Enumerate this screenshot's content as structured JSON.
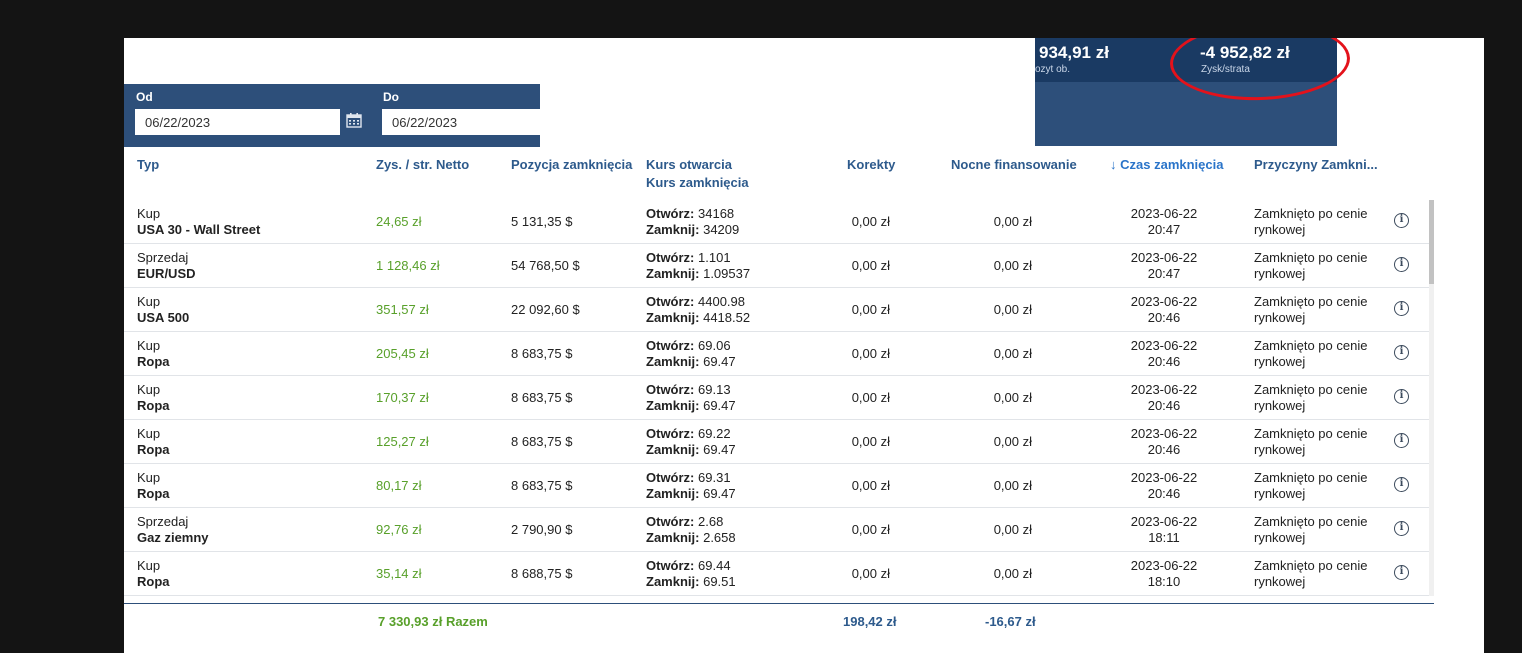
{
  "summary": {
    "deposit_value": "934,91 zł",
    "deposit_label": "ozyt ob.",
    "pl_value": "-4 952,82 zł",
    "pl_label": "Zysk/strata"
  },
  "filter": {
    "from_label": "Od",
    "from_value": "06/22/2023",
    "to_label": "Do",
    "to_value": "06/22/2023"
  },
  "headers": {
    "type": "Typ",
    "pl_net": "Zys. / str. Netto",
    "closed_position": "Pozycja zamknięcia",
    "open_rate": "Kurs otwarcia",
    "close_rate": "Kurs zamknięcia",
    "corrections": "Korekty",
    "overnight": "Nocne finansowanie",
    "close_time": "Czas zamknięcia",
    "close_time_arrow": "↓",
    "reasons": "Przyczyny Zamkni..."
  },
  "labels": {
    "open": "Otwórz:",
    "close": "Zamknij:"
  },
  "rows": [
    {
      "dir": "Kup",
      "instrument": "USA 30 - Wall Street",
      "pl": "24,65 zł",
      "position": "5 131,35 $",
      "open": "34168",
      "close": "34209",
      "corrections": "0,00 zł",
      "overnight": "0,00 zł",
      "date": "2023-06-22",
      "time": "20:47",
      "reason1": "Zamknięto po cenie",
      "reason2": "rynkowej"
    },
    {
      "dir": "Sprzedaj",
      "instrument": "EUR/USD",
      "pl": "1 128,46 zł",
      "position": "54 768,50 $",
      "open": "1.101",
      "close": "1.09537",
      "corrections": "0,00 zł",
      "overnight": "0,00 zł",
      "date": "2023-06-22",
      "time": "20:47",
      "reason1": "Zamknięto po cenie",
      "reason2": "rynkowej"
    },
    {
      "dir": "Kup",
      "instrument": "USA 500",
      "pl": "351,57 zł",
      "position": "22 092,60 $",
      "open": "4400.98",
      "close": "4418.52",
      "corrections": "0,00 zł",
      "overnight": "0,00 zł",
      "date": "2023-06-22",
      "time": "20:46",
      "reason1": "Zamknięto po cenie",
      "reason2": "rynkowej"
    },
    {
      "dir": "Kup",
      "instrument": "Ropa",
      "pl": "205,45 zł",
      "position": "8 683,75 $",
      "open": "69.06",
      "close": "69.47",
      "corrections": "0,00 zł",
      "overnight": "0,00 zł",
      "date": "2023-06-22",
      "time": "20:46",
      "reason1": "Zamknięto po cenie",
      "reason2": "rynkowej"
    },
    {
      "dir": "Kup",
      "instrument": "Ropa",
      "pl": "170,37 zł",
      "position": "8 683,75 $",
      "open": "69.13",
      "close": "69.47",
      "corrections": "0,00 zł",
      "overnight": "0,00 zł",
      "date": "2023-06-22",
      "time": "20:46",
      "reason1": "Zamknięto po cenie",
      "reason2": "rynkowej"
    },
    {
      "dir": "Kup",
      "instrument": "Ropa",
      "pl": "125,27 zł",
      "position": "8 683,75 $",
      "open": "69.22",
      "close": "69.47",
      "corrections": "0,00 zł",
      "overnight": "0,00 zł",
      "date": "2023-06-22",
      "time": "20:46",
      "reason1": "Zamknięto po cenie",
      "reason2": "rynkowej"
    },
    {
      "dir": "Kup",
      "instrument": "Ropa",
      "pl": "80,17 zł",
      "position": "8 683,75 $",
      "open": "69.31",
      "close": "69.47",
      "corrections": "0,00 zł",
      "overnight": "0,00 zł",
      "date": "2023-06-22",
      "time": "20:46",
      "reason1": "Zamknięto po cenie",
      "reason2": "rynkowej"
    },
    {
      "dir": "Sprzedaj",
      "instrument": "Gaz ziemny",
      "pl": "92,76 zł",
      "position": "2 790,90 $",
      "open": "2.68",
      "close": "2.658",
      "corrections": "0,00 zł",
      "overnight": "0,00 zł",
      "date": "2023-06-22",
      "time": "18:11",
      "reason1": "Zamknięto po cenie",
      "reason2": "rynkowej"
    },
    {
      "dir": "Kup",
      "instrument": "Ropa",
      "pl": "35,14 zł",
      "position": "8 688,75 $",
      "open": "69.44",
      "close": "69.51",
      "corrections": "0,00 zł",
      "overnight": "0,00 zł",
      "date": "2023-06-22",
      "time": "18:10",
      "reason1": "Zamknięto po cenie",
      "reason2": "rynkowej"
    }
  ],
  "totals": {
    "pl": "7 330,93 zł  Razem",
    "corrections": "198,42 zł",
    "overnight": "-16,67 zł"
  },
  "colors": {
    "header_blue": "#2d4f7a",
    "summary_dark": "#1a3a63",
    "profit_green": "#58a02a",
    "annotation_red": "#e3121b"
  }
}
